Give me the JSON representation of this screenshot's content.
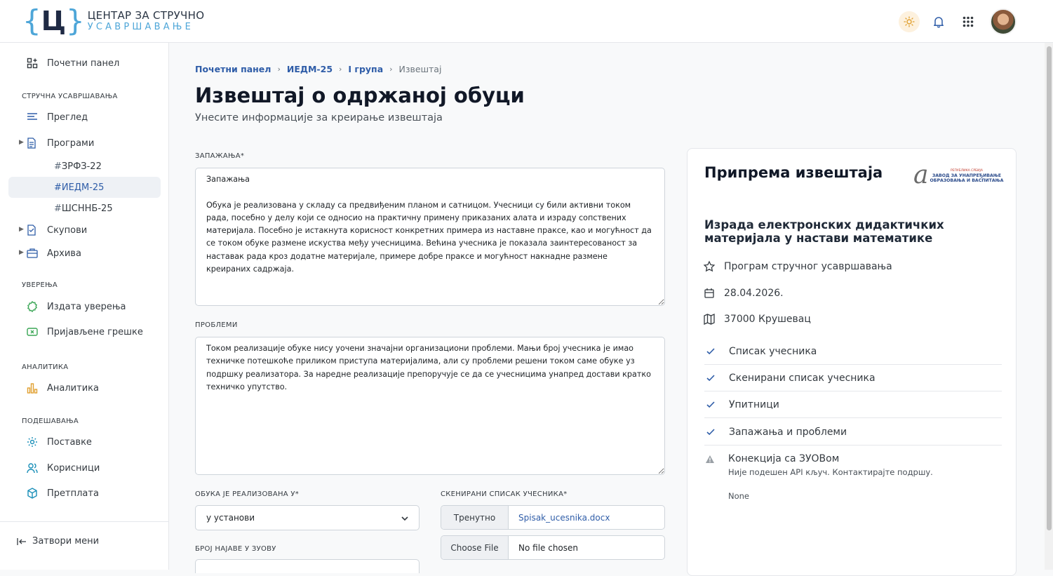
{
  "brand": {
    "line1": "ЦЕНТАР ЗА СТРУЧНО",
    "line2": "УСАВРШАВАЊЕ",
    "mark": "Ц",
    "accent": "#4ea6d8"
  },
  "sidebar": {
    "dashboard": "Почетни панел",
    "section_training": "СТРУЧНА УСАВРШАВАЊА",
    "overview": "Преглед",
    "programs": "Програми",
    "sub_programs": [
      "ЗРФЗ-22",
      "ИЕДМ-25",
      "ШСННБ-25"
    ],
    "hash": "#",
    "sets": "Скупови",
    "archive": "Архива",
    "section_certs": "УВЕРЕЊА",
    "issued_certs": "Издата уверења",
    "reported_errors": "Пријављене грешке",
    "section_analytics": "АНАЛИТИКА",
    "analytics": "Аналитика",
    "section_settings": "ПОДЕШАВАЊА",
    "settings": "Поставке",
    "users": "Корисници",
    "subscription": "Претплата",
    "close_menu": "Затвори мени"
  },
  "breadcrumb": [
    "Почетни панел",
    "ИЕДМ-25",
    "I група",
    "Извештај"
  ],
  "page": {
    "title": "Извештај о одржаној обуци",
    "subtitle": "Унесите информације за креирање извештаја"
  },
  "form": {
    "observations_label": "ЗАПАЖАЊА*",
    "observations_value": "Запажања\n\nОбука је реализована у складу са предвиђеним планом и сатницом. Учесници су били активни током рада, посебно у делу који се односио на практичну примену приказаних алата и израду сопствених материјала. Посебно је истакнута корисност конкретних примера из наставне праксе, као и могућност да се током обуке размене искуства међу учесницима. Већина учесника је показала заинтересованост за наставак рада кроз додатне материјале, примере добре праксе и могућност накнадне размене креираних садржаја.",
    "problems_label": "ПРОБЛЕМИ",
    "problems_value": "Током реализације обуке нису уочени значајни организациони проблеми. Мањи број учесника је имао техничке потешкоће приликом приступа материјалима, али су проблеми решени током саме обуке уз подршку реализатора. За наредне реализације препоручује се да се учесницима унапред достави кратко техничко упутство.",
    "location_label": "ОБУКА ЈЕ РЕАЛИЗОВАНА У*",
    "location_value": "у установи",
    "scan_label": "СКЕНИРАНИ СПИСАК УЧЕСНИКА*",
    "current_label": "Тренутно",
    "current_file": "Spisak_ucesnika.docx",
    "choose_file": "Choose File",
    "no_file": "No file chosen",
    "announce_label": "БРОЈ НАЈАВЕ У ЗУОВУ"
  },
  "card": {
    "title": "Припрема извештаја",
    "logo_a": "a",
    "logo_small": "РЕПУБЛИКА СРБИЈА",
    "logo_l1": "ЗАВОД ЗА УНАПРЕЂИВАЊЕ",
    "logo_l2": "ОБРАЗОВАЊА И ВАСПИТАЊА",
    "program_title": "Израда електронских дидактичких материјала у настави математике",
    "program_type": "Програм стручног усавршавања",
    "date": "28.04.2026.",
    "place": "37000 Крушевац",
    "checks": [
      "Списак учесника",
      "Скенирани списак учесника",
      "Упитници",
      "Запажања и проблеми"
    ],
    "warn_title": "Конекција са ЗУОВом",
    "warn_sub": "Није подешен API кључ. Контактирајте подршу.",
    "none": "None"
  },
  "icons": {
    "theme": "sun-icon",
    "notifications": "bell-icon",
    "apps": "grid-icon",
    "check": "check-icon",
    "warning": "warning-icon"
  }
}
